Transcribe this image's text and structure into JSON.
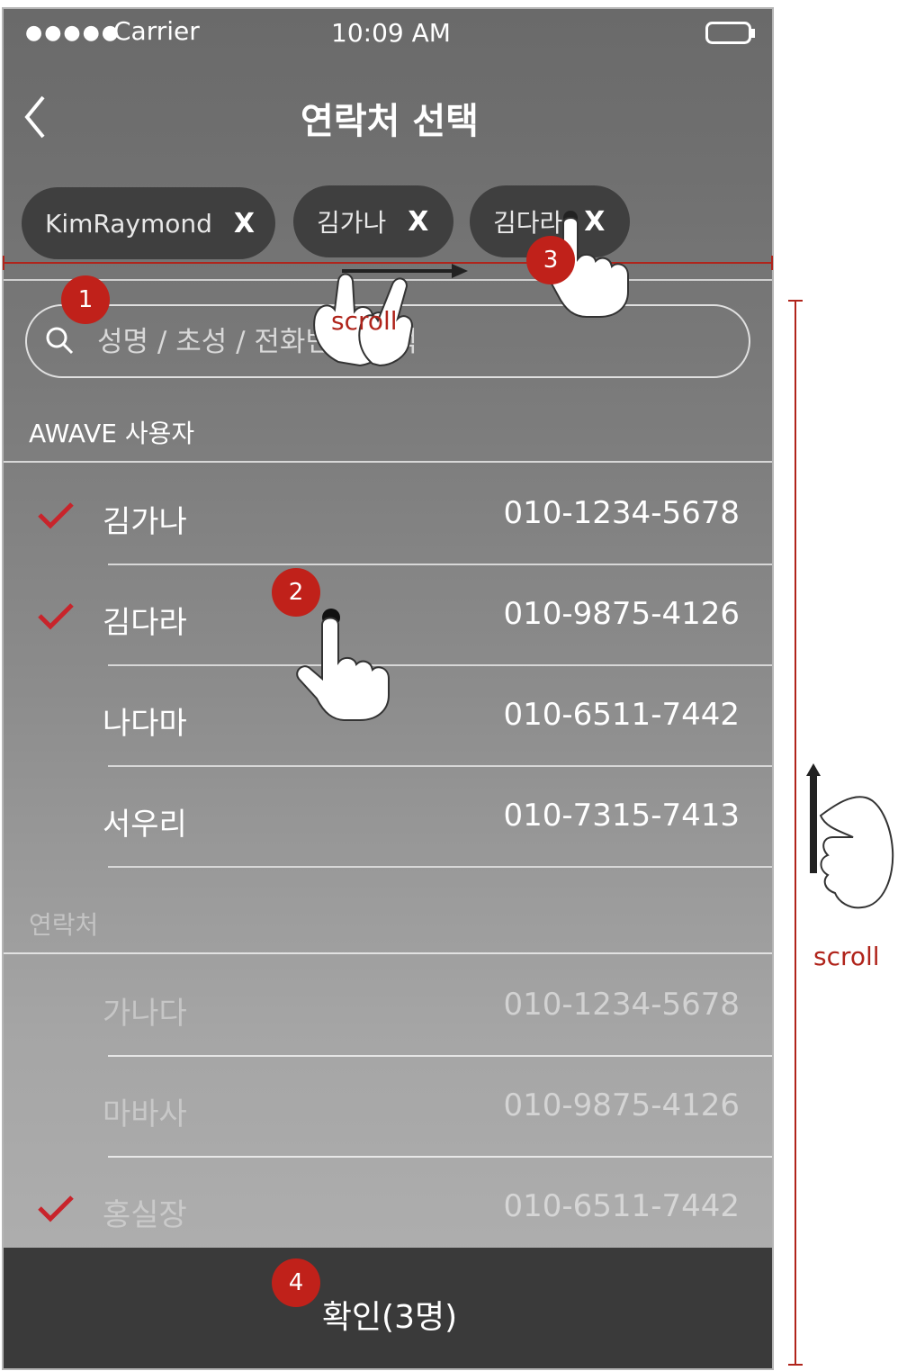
{
  "status_bar": {
    "signal": "●●●●●",
    "carrier": "Carrier",
    "time": "10:09 AM",
    "icons": [
      "battery-icon"
    ]
  },
  "nav": {
    "title": "연락처 선택",
    "icons": [
      "chevron-left-icon"
    ]
  },
  "selected_chips": [
    {
      "label": "KimRaymond",
      "remove": "X"
    },
    {
      "label": "김가나",
      "remove": "X"
    },
    {
      "label": "김다라",
      "remove": "X"
    }
  ],
  "search": {
    "placeholder": "성명 / 초성 / 전화번호 검색",
    "value": "",
    "icon": "search-icon"
  },
  "sections": [
    {
      "title": "AWAVE 사용자",
      "rows": [
        {
          "name": "김가나",
          "phone": "010-1234-5678",
          "checked": true
        },
        {
          "name": "김다라",
          "phone": "010-9875-4126",
          "checked": true
        },
        {
          "name": "나다마",
          "phone": "010-6511-7442",
          "checked": false
        },
        {
          "name": "서우리",
          "phone": "010-7315-7413",
          "checked": false
        }
      ]
    },
    {
      "title": "연락처",
      "rows": [
        {
          "name": "가나다",
          "phone": "010-1234-5678",
          "checked": false
        },
        {
          "name": "마바사",
          "phone": "010-9875-4126",
          "checked": false
        },
        {
          "name": "홍실장",
          "phone": "010-6511-7442",
          "checked": true
        }
      ]
    }
  ],
  "confirm_button": {
    "label": "확인(3명)"
  },
  "annotations": {
    "badges": [
      "1",
      "2",
      "3",
      "4"
    ],
    "chip_scroll_label": "scroll",
    "list_scroll_label": "scroll",
    "accent_color": "#c0211a",
    "icons": [
      "hand-pointer-icon",
      "swipe-hand-icon",
      "scroll-gesture-icon"
    ]
  }
}
